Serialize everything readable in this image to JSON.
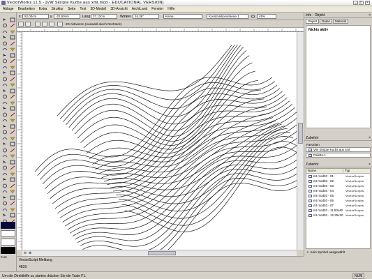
{
  "app": {
    "title": "VectorWorks 11.5 - [VW Skripte Kurbs aus xml.mcd - EDUCATIONAL VERSION]",
    "window_buttons": [
      "_",
      "□",
      "×"
    ]
  },
  "menu": {
    "items": [
      "Ablage",
      "Bearbeiten",
      "Extra",
      "Struktur",
      "Seite",
      "Text",
      "3D-Modell",
      "3D-Ansicht",
      "ArchiLand",
      "Fenster",
      "Hilfe"
    ]
  },
  "databar": {
    "x_value": "52,00cm",
    "y_value": "-22,50cm",
    "length_label": "Lang",
    "length_value": "37,12cm",
    "angle_label": "Winkel",
    "angle_value": "34,36°",
    "class_value": "Keine",
    "layer_value": "Konstruktionsebene-1",
    "zoom_value": "45%"
  },
  "viewbar": {
    "mode_label": "2D Aktivieren (Auswahl durch Rechteck)"
  },
  "status": {
    "script_title": "VectorScript-Meldung",
    "script_value": "4839",
    "help_text": "Um die Direkthilfe zu starten drücken Sie die Taste F1.",
    "num_indicator": "NUM",
    "scale_value": "0,16"
  },
  "info_panel": {
    "title": "Info - Objekt",
    "tabs": [
      "Objekt",
      "Daten",
      "Material"
    ],
    "status_text": "Nichts aktiv"
  },
  "favorites_panel": {
    "title": "Zubehör",
    "favorites_label": "Favoriten",
    "favorites_value": "VW Skripte Kurbs aus xml",
    "palette_value": "Palette-1"
  },
  "resources_panel": {
    "title": "Zubehör",
    "col_name": "Name",
    "col_type": "Typ",
    "items": [
      {
        "name": "mt mod03 - 01",
        "type": "VectorScripts"
      },
      {
        "name": "mt mod03 - 02",
        "type": "VectorScripts"
      },
      {
        "name": "mt mod03 - 03",
        "type": "VectorScripts"
      },
      {
        "name": "mt mod03 - 04",
        "type": "VectorScripts"
      },
      {
        "name": "mt mod03 - 05",
        "type": "VectorScripts"
      },
      {
        "name": "mt mod03 - 06",
        "type": "VectorScripts"
      },
      {
        "name": "mt mod03 - 07",
        "type": "VectorScripts"
      },
      {
        "name": "mt mod03 - 11 50x40",
        "type": "VectorScripts"
      },
      {
        "name": "mt mod03 - 12 25x20",
        "type": "VectorScripts"
      }
    ],
    "footer_text": "Kein Symbol ausgewählt"
  },
  "colors": {
    "canvas_bg": "#ffffff",
    "ui_face": "#d4d0c8",
    "curve_stroke": "#1a1a1a"
  }
}
